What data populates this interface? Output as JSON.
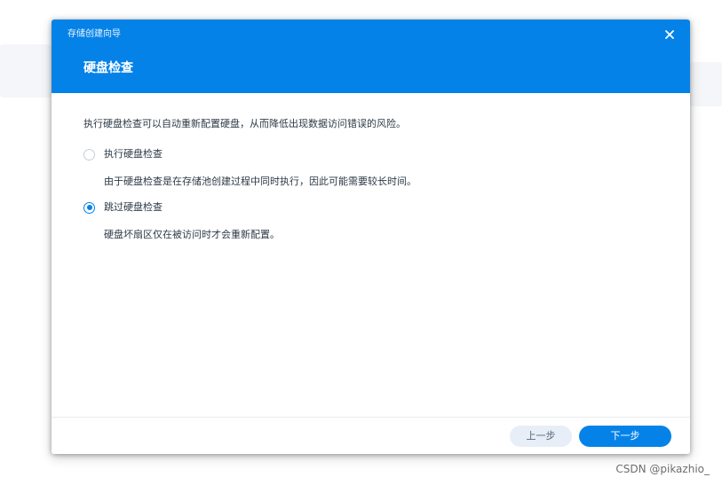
{
  "dialog": {
    "app_title": "存储创建向导",
    "step_title": "硬盘检查",
    "intro": "执行硬盘检查可以自动重新配置硬盘，从而降低出现数据访问错误的风险。",
    "options": [
      {
        "label": "执行硬盘检查",
        "description": "由于硬盘检查是在存储池创建过程中同时执行，因此可能需要较长时间。",
        "selected": false
      },
      {
        "label": "跳过硬盘检查",
        "description": "硬盘坏扇区仅在被访问时才会重新配置。",
        "selected": true
      }
    ],
    "buttons": {
      "prev": "上一步",
      "next": "下一步"
    },
    "close_icon": "close-icon"
  },
  "watermark": "CSDN @pikazhio_",
  "colors": {
    "accent": "#0582e8",
    "header_bg": "#0582e8",
    "text": "#2d3a47",
    "secondary_button_bg": "#e7eef7"
  }
}
